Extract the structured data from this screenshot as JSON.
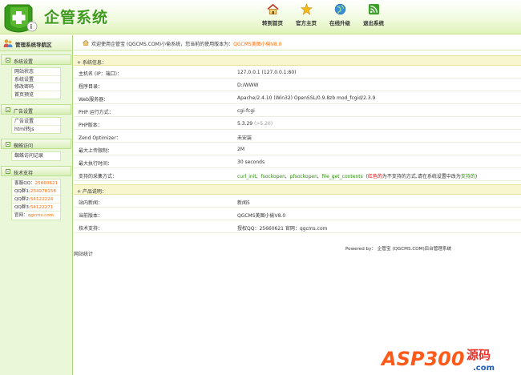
{
  "app": {
    "title": "企管系统"
  },
  "topnav": [
    {
      "label": "转到首页",
      "icon": "home-icon"
    },
    {
      "label": "官方主页",
      "icon": "star-icon"
    },
    {
      "label": "在线升级",
      "icon": "globe-icon"
    },
    {
      "label": "退出系统",
      "icon": "rss-icon"
    }
  ],
  "sidebar": {
    "header": "管理系统导航区",
    "groups": [
      {
        "title": "系统设置",
        "items": [
          "网站状态",
          "系统设置",
          "修改密码",
          "首页预览"
        ]
      },
      {
        "title": "广告设置",
        "items": [
          "广告设置",
          "html转js"
        ]
      },
      {
        "title": "蜘蛛访问",
        "items": [
          "蜘蛛访问记录"
        ]
      },
      {
        "title": "技术支持"
      }
    ],
    "contacts": [
      {
        "label": "客服QQ：",
        "value": "25660621"
      },
      {
        "label": "QQ群1:",
        "value": "234978158"
      },
      {
        "label": "QQ群2:",
        "value": "54122224"
      },
      {
        "label": "QQ群3:",
        "value": "54122271"
      },
      {
        "label": "官网：",
        "value": "qgcms.com"
      }
    ]
  },
  "main": {
    "welcome_prefix": "欢迎使用企管宝 (QGCMS.COM)小偷系统，您当前的使用版本为：",
    "welcome_version": "QGCMS美图小偷V8.0",
    "system_section": "+ 系统信息：",
    "system_rows": [
      {
        "key": "主机名 (IP：端口)：",
        "value": "127.0.0.1  (127.0.0.1:80)"
      },
      {
        "key": "程序目录：",
        "value": "D:/WWW"
      },
      {
        "key": "Web服务器：",
        "value": "Apache/2.4.10 (Win32) OpenSSL/0.9.8zb mod_fcgid/2.3.9"
      },
      {
        "key": "PHP 运行方式：",
        "value": "cgi-fcgi"
      },
      {
        "key": "PHP版本：",
        "value": "5.3.29",
        "extra": "(>5.20)"
      },
      {
        "key": "Zend Optimizer：",
        "value": "未安装"
      },
      {
        "key": "最大上传限制：",
        "value": "2M"
      },
      {
        "key": "最大执行时间：",
        "value": "30 seconds"
      },
      {
        "key": "支持的采集方式：",
        "methods": [
          "curl_init",
          "fsockopen",
          "pfsockopen",
          "file_get_contents"
        ],
        "note_red": "红色的",
        "note_mid": "为不支持的方式,请在系统设置中改为",
        "note_green": "支持的"
      }
    ],
    "product_section": "+ 产品说明：",
    "product_rows": [
      {
        "key": "站内新闻：",
        "value": "新闻5"
      },
      {
        "key": "当前版本：",
        "value": "QGCMS美图小偷V8.0"
      },
      {
        "key": "技术支持：",
        "value": "授权QQ：25660621    官网：qgcms.com"
      }
    ],
    "powered": "Powered by： 企管宝 (QGCMS.COM)后台管理系统",
    "stats": "网站统计"
  },
  "watermark": {
    "text": "ASP300",
    "tag": "源码",
    "domain": ".com"
  },
  "colors": {
    "brand_green": "#3e9b1c",
    "accent_orange": "#ff6a00",
    "warn_red": "#e60000",
    "section_bg": "#f8f6cf"
  }
}
